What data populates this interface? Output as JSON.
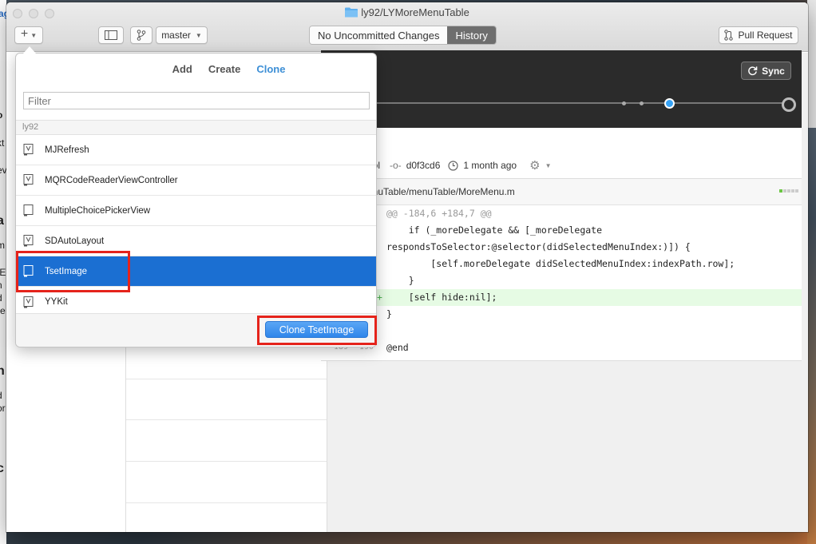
{
  "window": {
    "title": "ly92/LYMoreMenuTable"
  },
  "toolbar": {
    "add_label": "+",
    "branch_label": "master",
    "segment": [
      {
        "label": "No Uncommitted Changes",
        "active": false
      },
      {
        "label": "History",
        "active": true
      }
    ],
    "pull_request_label": "Pull Request"
  },
  "sync": {
    "label": "Sync"
  },
  "commit": {
    "author": "pol",
    "sha": "d0f3cd6",
    "time": "1 month ago"
  },
  "file": {
    "path": "enuTable/menuTable/MoreMenu.m"
  },
  "diff": {
    "lines": [
      {
        "type": "hunk",
        "old": "",
        "new": "",
        "mark": "",
        "code": "@@ -184,6 +184,7 @@"
      },
      {
        "type": "ctx",
        "old": "",
        "new": "",
        "mark": "",
        "code": "    if (_moreDelegate && [_moreDelegate"
      },
      {
        "type": "ctx",
        "old": "",
        "new": "",
        "mark": "",
        "code": "respondsToSelector:@selector(didSelectedMenuIndex:)]) {"
      },
      {
        "type": "ctx",
        "old": "",
        "new": "",
        "mark": "",
        "code": "        [self.moreDelegate didSelectedMenuIndex:indexPath.row];"
      },
      {
        "type": "ctx",
        "old": "",
        "new": "",
        "mark": "",
        "code": "    }"
      },
      {
        "type": "add",
        "old": "",
        "new": "",
        "mark": "+",
        "code": "    [self hide:nil];"
      },
      {
        "type": "ctx",
        "old": "",
        "new": "",
        "mark": "",
        "code": "}"
      },
      {
        "type": "ctx",
        "old": "",
        "new": "",
        "mark": "",
        "code": ""
      },
      {
        "type": "ctx",
        "old": "189",
        "new": "190",
        "mark": "",
        "code": "@end"
      }
    ]
  },
  "panel": {
    "tabs": [
      "Add",
      "Create",
      "Clone"
    ],
    "active_tab": "Clone",
    "filter_placeholder": "Filter",
    "owner": "ly92",
    "repos": [
      {
        "name": "MJRefresh",
        "selected": false
      },
      {
        "name": "MQRCodeReaderViewController",
        "selected": false
      },
      {
        "name": "MultipleChoicePickerView",
        "selected": false
      },
      {
        "name": "SDAutoLayout",
        "selected": false
      },
      {
        "name": "TsetImage",
        "selected": true
      },
      {
        "name": "YYKit",
        "selected": false
      }
    ],
    "clone_button": "Clone TsetImage"
  },
  "colors": {
    "accent": "#3d8fd6",
    "selection": "#1b6fd2",
    "highlight": "#e5231b",
    "added_line": "#e6fbe4"
  }
}
